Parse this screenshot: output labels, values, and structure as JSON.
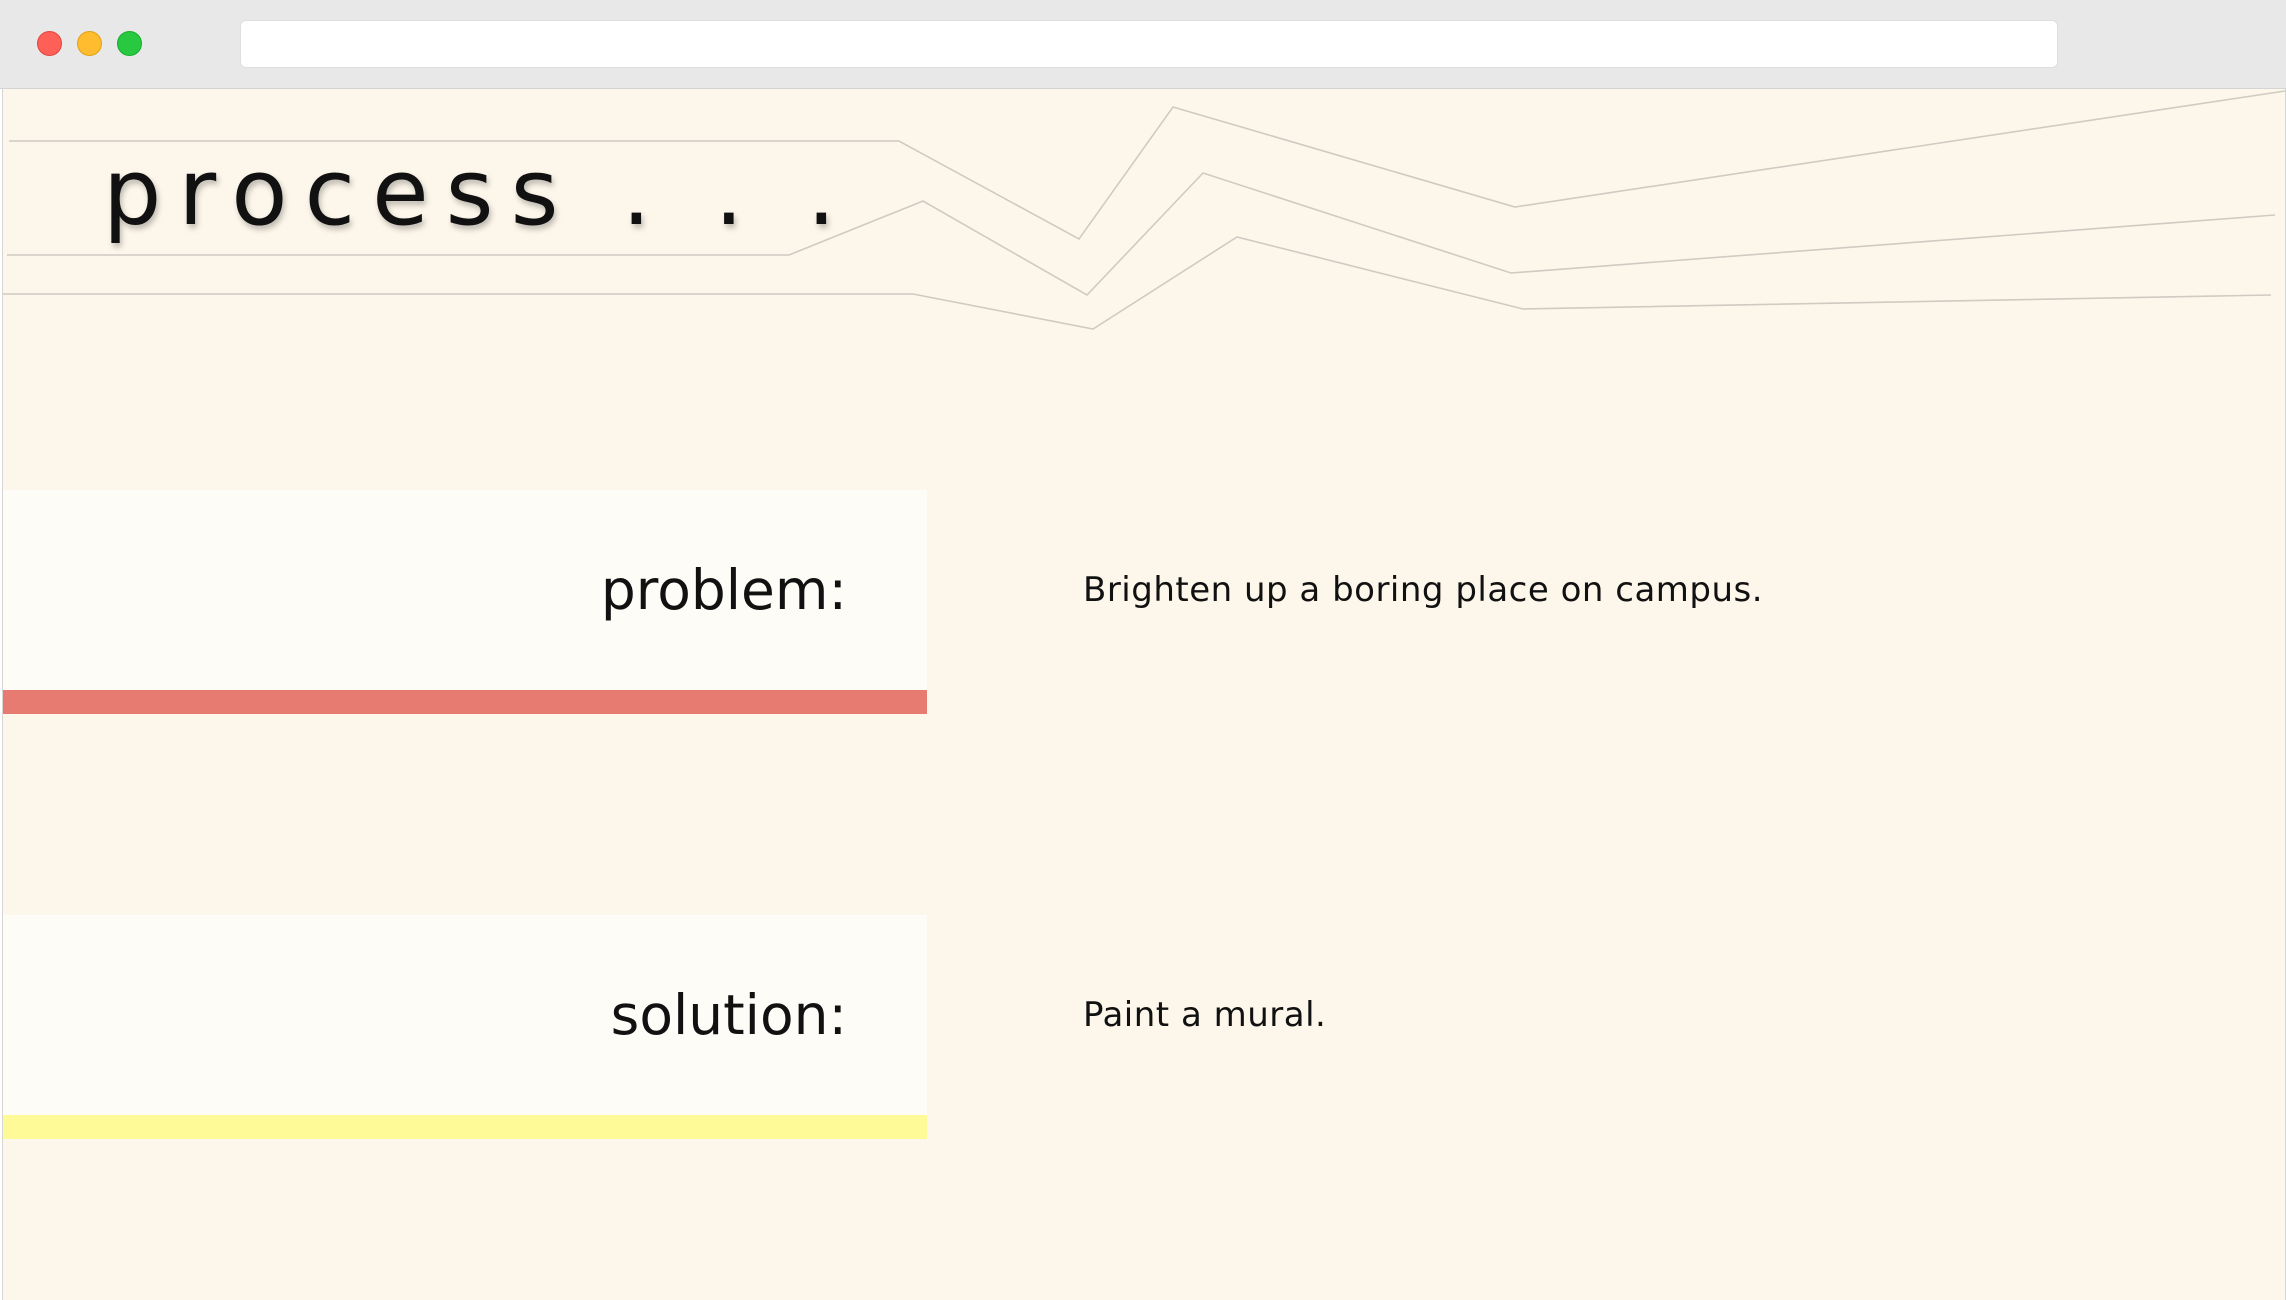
{
  "browser": {
    "url": "",
    "buttons": {
      "close": "close-icon",
      "minimize": "minimize-icon",
      "maximize": "maximize-icon"
    }
  },
  "page": {
    "title": "process . . .",
    "background_color": "#fdf7eb",
    "sections": [
      {
        "label": "problem:",
        "text": "Brighten up a boring place on campus.",
        "accent_color": "#e77b71"
      },
      {
        "label": "solution:",
        "text": "Paint a mural.",
        "accent_color": "#fefa97"
      }
    ]
  }
}
